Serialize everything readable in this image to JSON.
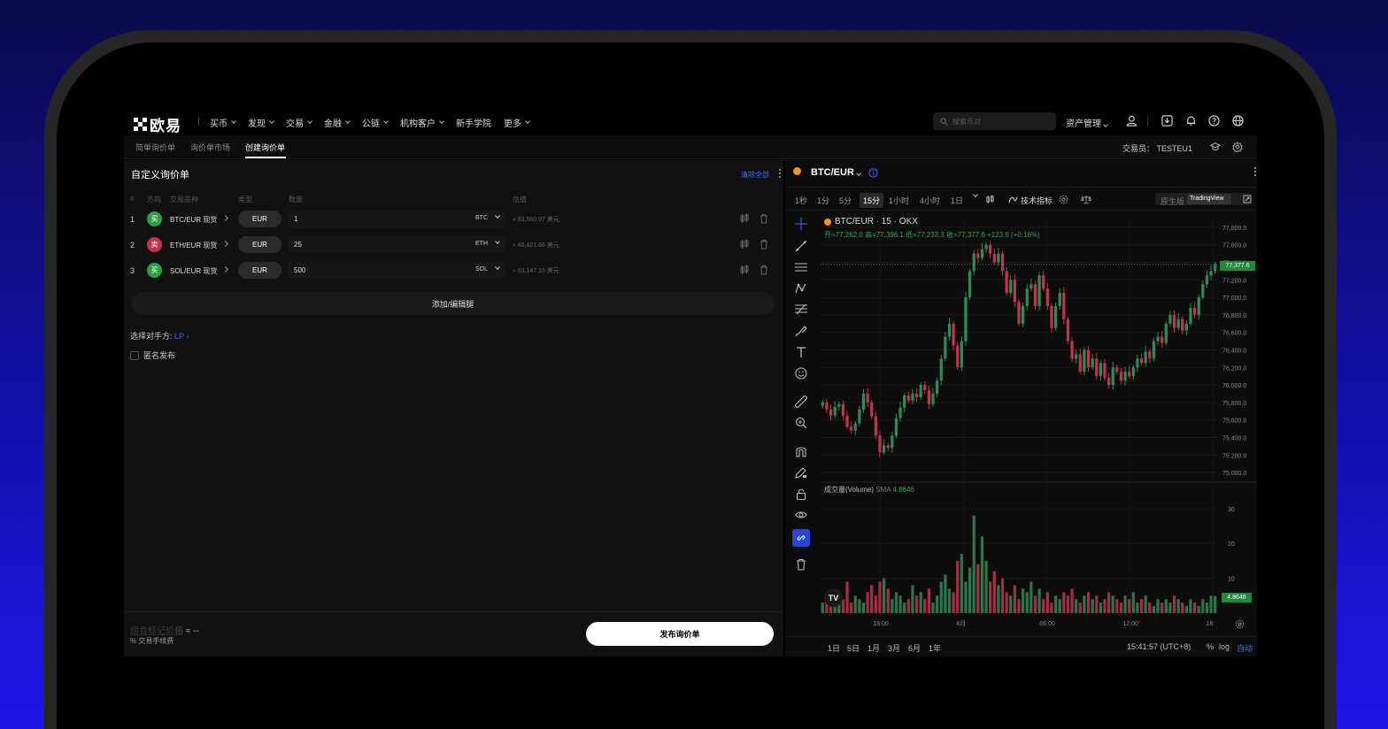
{
  "nav": {
    "logo_text": "欧易",
    "menu": [
      {
        "label": "买币",
        "dropdown": true
      },
      {
        "label": "发现",
        "dropdown": true
      },
      {
        "label": "交易",
        "dropdown": true
      },
      {
        "label": "金融",
        "dropdown": true
      },
      {
        "label": "公链",
        "dropdown": true
      },
      {
        "label": "机构客户",
        "dropdown": true
      },
      {
        "label": "新手学院",
        "dropdown": false
      },
      {
        "label": "更多",
        "dropdown": true
      }
    ],
    "search_placeholder": "搜索币对",
    "asset_label": "资产管理",
    "icons": [
      "user-icon",
      "download-icon",
      "bell-icon",
      "help-icon",
      "globe-icon"
    ]
  },
  "subnav": {
    "tabs": [
      "简单询价单",
      "询价单市场",
      "创建询价单"
    ],
    "active_tab": 2,
    "trader_label": "交易员：",
    "trader_value": "TESTEU1"
  },
  "rfq": {
    "title": "自定义询价单",
    "clear_all": "清除全部",
    "headers": [
      "#",
      "方向",
      "交易品种",
      "类型",
      "数量",
      "估值"
    ],
    "legs": [
      {
        "index": "1",
        "side": "买",
        "side_type": "buy",
        "instrument": "BTC/EUR 现货",
        "type": "EUR",
        "quantity": "1",
        "unit": "BTC",
        "estimate": "≈ 83,560.07 美元"
      },
      {
        "index": "2",
        "side": "卖",
        "side_type": "sell",
        "instrument": "ETH/EUR 现货",
        "type": "EUR",
        "quantity": "25",
        "unit": "ETH",
        "estimate": "≈ 46,421.66 美元"
      },
      {
        "index": "3",
        "side": "买",
        "side_type": "buy",
        "instrument": "SOL/EUR 现货",
        "type": "EUR",
        "quantity": "500",
        "unit": "SOL",
        "estimate": "≈ 63,147.15 美元"
      }
    ],
    "add_edit_label": "添加/编辑腿",
    "counterparty_label": "选择对手方:",
    "counterparty_value": "LP",
    "anonymous_label": "匿名发布",
    "footer_label": "组合标记价格",
    "footer_value": "≈ --",
    "footer_fee": "% 交易手续费",
    "publish_label": "发布询价单"
  },
  "chart_panel": {
    "pair": "BTC/EUR",
    "timeframes": [
      "1秒",
      "1分",
      "5分",
      "15分",
      "1小时",
      "4小时",
      "1日"
    ],
    "active_timeframe": "15分",
    "indicators_label": "技术指标",
    "mode_native": "原生版",
    "mode_tv": "TradingView",
    "legend_title": "BTC/EUR · 15 · OKX",
    "ohlc_text": "开=77,262.0 高=77,396.1 低=77,233.3 收=77,377.6 +123.6 (+0.16%)",
    "volume_label": "成交量(Volume)",
    "volume_sma": "SMA",
    "volume_sma_value": "4.8646",
    "last_price_label": "77,377.6",
    "range_buttons": [
      "1日",
      "5日",
      "1月",
      "3月",
      "6月",
      "1年"
    ],
    "time_label": "15:41:57 (UTC+8)",
    "pct_label": "%",
    "log_label": "log",
    "auto_label": "自动",
    "tv_logo": "TV",
    "colors": {
      "up": "#2e8b57",
      "down": "#c2344d",
      "accent": "#3d6bff",
      "last_price_bg": "#1e8a3c"
    }
  },
  "chart_data": {
    "type": "candlestick",
    "price_axis": [
      "77,800.0",
      "77,600.0",
      "77,400.0",
      "77,200.0",
      "77,000.0",
      "76,800.0",
      "76,600.0",
      "76,400.0",
      "76,200.0",
      "76,000.0",
      "75,800.0",
      "75,600.0",
      "75,400.0",
      "75,200.0",
      "75,000.0"
    ],
    "ylim": [
      74950,
      77900
    ],
    "time_axis": [
      "18:00",
      "4月",
      "06:00",
      "12:00",
      "18:"
    ],
    "volume_axis": [
      "30",
      "20",
      "10"
    ],
    "volume_ylim": [
      0,
      34
    ],
    "candles": [
      75800,
      75720,
      75650,
      75750,
      75780,
      75650,
      75520,
      75480,
      75560,
      75720,
      75900,
      75800,
      75640,
      75420,
      75230,
      75310,
      75280,
      75420,
      75620,
      75740,
      75880,
      75820,
      75900,
      75860,
      76000,
      75940,
      75780,
      75900,
      76050,
      76300,
      76550,
      76700,
      76450,
      76200,
      76500,
      77000,
      77300,
      77500,
      77450,
      77550,
      77600,
      77500,
      77400,
      77500,
      77300,
      77050,
      77200,
      76950,
      76700,
      76900,
      77100,
      77150,
      76900,
      77250,
      77100,
      76900,
      76650,
      76900,
      77050,
      76750,
      76500,
      76300,
      76350,
      76150,
      76400,
      76200,
      76300,
      76100,
      76250,
      76080,
      76000,
      76200,
      76150,
      76050,
      76150,
      76100,
      76200,
      76300,
      76250,
      76380,
      76300,
      76500,
      76550,
      76480,
      76700,
      76800,
      76650,
      76750,
      76620,
      76700,
      76880,
      76800,
      77000,
      77150,
      77250,
      77300,
      77377.6
    ],
    "volumes": [
      3,
      5,
      4,
      2,
      6,
      4,
      9,
      3,
      5,
      4,
      3,
      6,
      8,
      5,
      9,
      10,
      7,
      4,
      6,
      5,
      3,
      4,
      8,
      5,
      6,
      4,
      7,
      3,
      5,
      9,
      11,
      7,
      6,
      15,
      17,
      9,
      13,
      28,
      14,
      22,
      15,
      9,
      12,
      8,
      10,
      6,
      5,
      8,
      4,
      7,
      6,
      9,
      5,
      7,
      4,
      6,
      3,
      5,
      4,
      6,
      5,
      7,
      4,
      3,
      5,
      6,
      4,
      5,
      3,
      4,
      6,
      5,
      4,
      3,
      5,
      4,
      6,
      3,
      4,
      5,
      3,
      2,
      4,
      3,
      4,
      3,
      5,
      4,
      3,
      2,
      4,
      3,
      2,
      4,
      3,
      5,
      4.8646
    ]
  }
}
